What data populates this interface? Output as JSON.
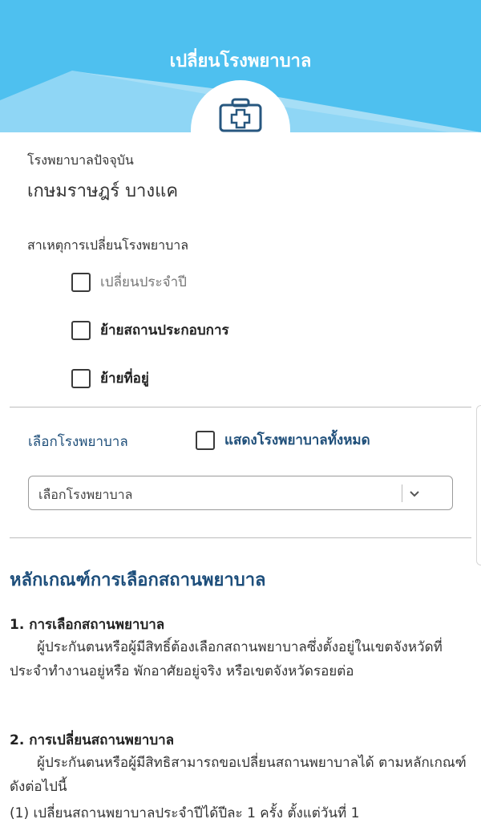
{
  "header": {
    "title": "เปลี่ยนโรงพยาบาล",
    "icon": "medical-kit-icon",
    "bg_color": "#4ec0ef"
  },
  "current_hospital": {
    "label": "โรงพยาบาลปัจจุบัน",
    "name": "เกษมราษฎร์ บางแค"
  },
  "reason": {
    "label": "สาเหตุการเปลี่ยนโรงพยาบาล",
    "options": [
      {
        "label": "เปลี่ยนประจำปี",
        "checked": false
      },
      {
        "label": "ย้ายสถานประกอบการ",
        "checked": false
      },
      {
        "label": "ย้ายที่อยู่",
        "checked": false
      }
    ]
  },
  "select_hospital": {
    "label": "เลือกโรงพยาบาล",
    "show_all_label": "แสดงโรงพยาบาลทั้งหมด",
    "show_all_checked": false,
    "dropdown_value": "เลือกโรงพยาบาล"
  },
  "rules": {
    "title": "หลักเกณฑ์การเลือกสถานพยาบาล",
    "sections": [
      {
        "heading": "1. การเลือกสถานพยาบาล",
        "body": "ผู้ประกันตนหรือผู้มีสิทธิ์ต้องเลือกสถานพยาบาลซึ่งตั้งอยู่ในเขตจังหวัดที่ประจำทำงานอยู่หรือ พักอาศัยอยู่จริง หรือเขตจังหวัดรอยต่อ"
      },
      {
        "heading": "2. การเปลี่ยนสถานพยาบาล",
        "body": "ผู้ประกันตนหรือผู้มีสิทธิสามารถขอเปลี่ยนสถานพยาบาลได้ ตามหลักเกณฑ์ ดังต่อไปนี้",
        "item": "(1) เปลี่ยนสถานพยาบาลประจำปีได้ปีละ 1 ครั้ง ตั้งแต่วันที่ 1"
      }
    ]
  }
}
